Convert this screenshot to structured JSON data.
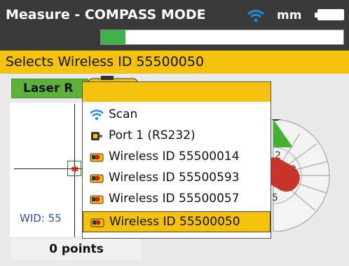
{
  "header": {
    "title": "Measure - COMPASS MODE",
    "unit": "mm",
    "progress_fraction": 0.1
  },
  "status_text": "Selects Wireless ID 55500050",
  "left_panel": {
    "laser_button_label": "Laser R",
    "wid_text": "WID: 55",
    "points_label": "0 points"
  },
  "menu": {
    "items": [
      {
        "label": "Scan",
        "icon": "wifi-icon"
      },
      {
        "label": "Port 1 (RS232)",
        "icon": "port-icon"
      },
      {
        "label": "Wireless ID 55500014",
        "icon": "sensor-icon"
      },
      {
        "label": "Wireless ID 55500593",
        "icon": "sensor-icon"
      },
      {
        "label": "Wireless ID 55500057",
        "icon": "sensor-icon"
      },
      {
        "label": "Wireless ID 55500050",
        "icon": "sensor-icon",
        "selected": true
      }
    ]
  },
  "dial_numbers": [
    "2",
    "3",
    "5"
  ],
  "colors": {
    "titlebar": "#3a3a3a",
    "accent": "#f4c10d",
    "progress": "#3fb24a",
    "laser_button": "#5cb23c"
  }
}
